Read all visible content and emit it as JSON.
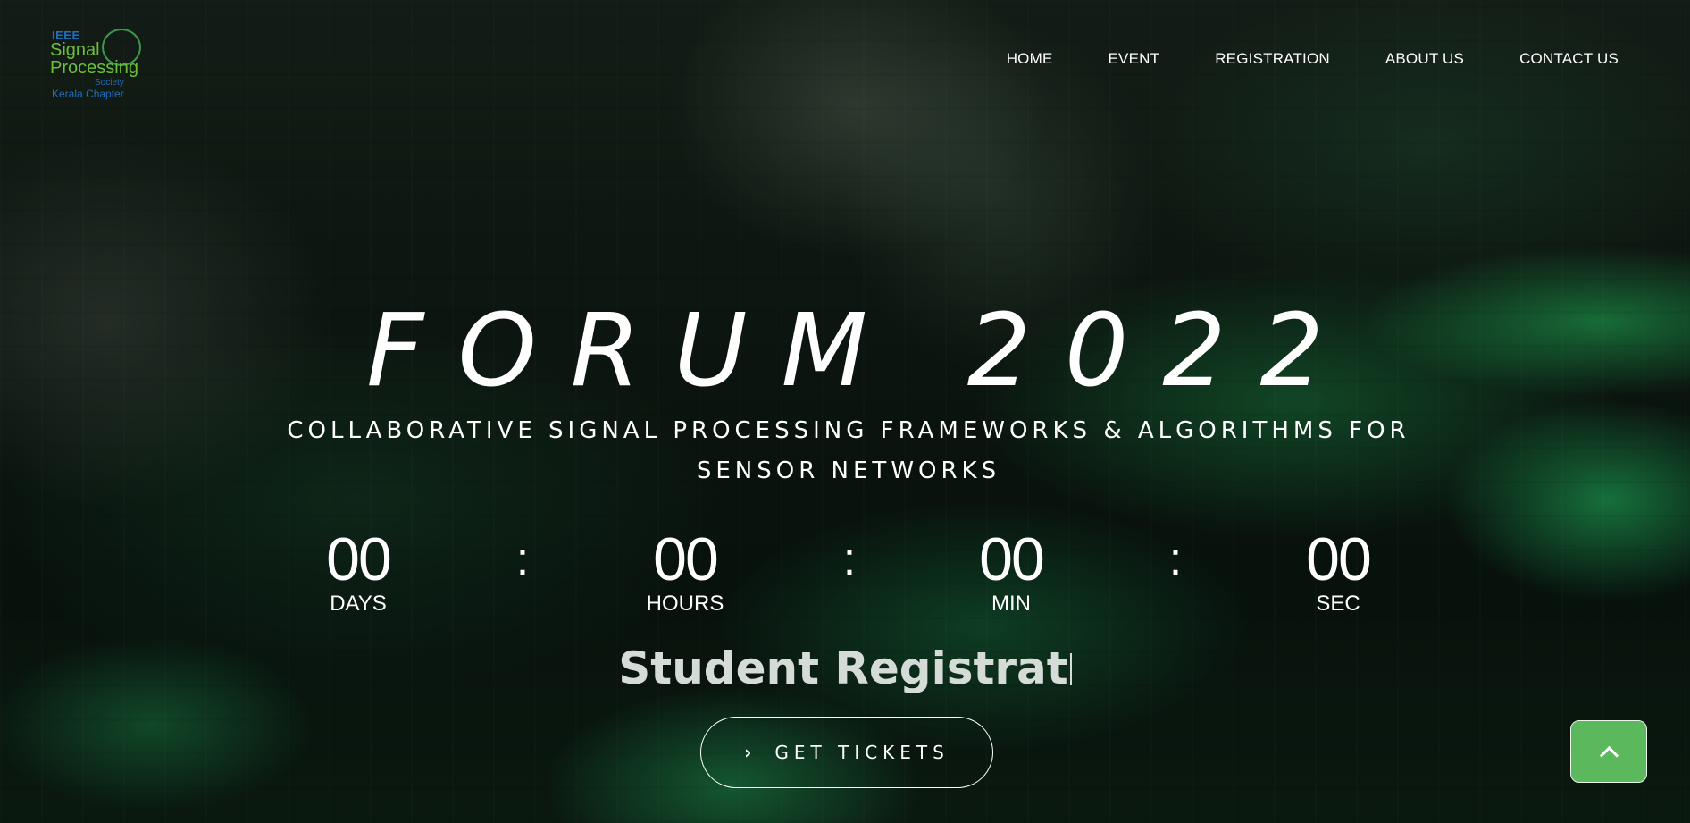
{
  "logo": {
    "org": "IEEE",
    "line1": "Signal",
    "line2": "Processing",
    "society": "Society",
    "chapter": "Kerala Chapter",
    "colors": {
      "green": "#6bbf3a",
      "blue": "#1f6fbf"
    }
  },
  "nav": {
    "items": [
      {
        "label": "HOME"
      },
      {
        "label": "EVENT"
      },
      {
        "label": "REGISTRATION"
      },
      {
        "label": "ABOUT US"
      },
      {
        "label": "CONTACT US"
      }
    ]
  },
  "hero": {
    "title": "FORUM 2022",
    "subtitle": "COLLABORATIVE SIGNAL PROCESSING FRAMEWORKS & ALGORITHMS FOR SENSOR NETWORKS",
    "typed_text": "Student Registrat"
  },
  "countdown": {
    "units": [
      {
        "value": "00",
        "label": "DAYS"
      },
      {
        "value": "00",
        "label": "HOURS"
      },
      {
        "value": "00",
        "label": "MIN"
      },
      {
        "value": "00",
        "label": "SEC"
      }
    ],
    "separator": ":"
  },
  "cta": {
    "label": "GET TICKETS",
    "icon": "chevron-right-icon"
  },
  "scroll_top": {
    "icon": "chevron-up-icon",
    "color": "#5cb85c"
  }
}
